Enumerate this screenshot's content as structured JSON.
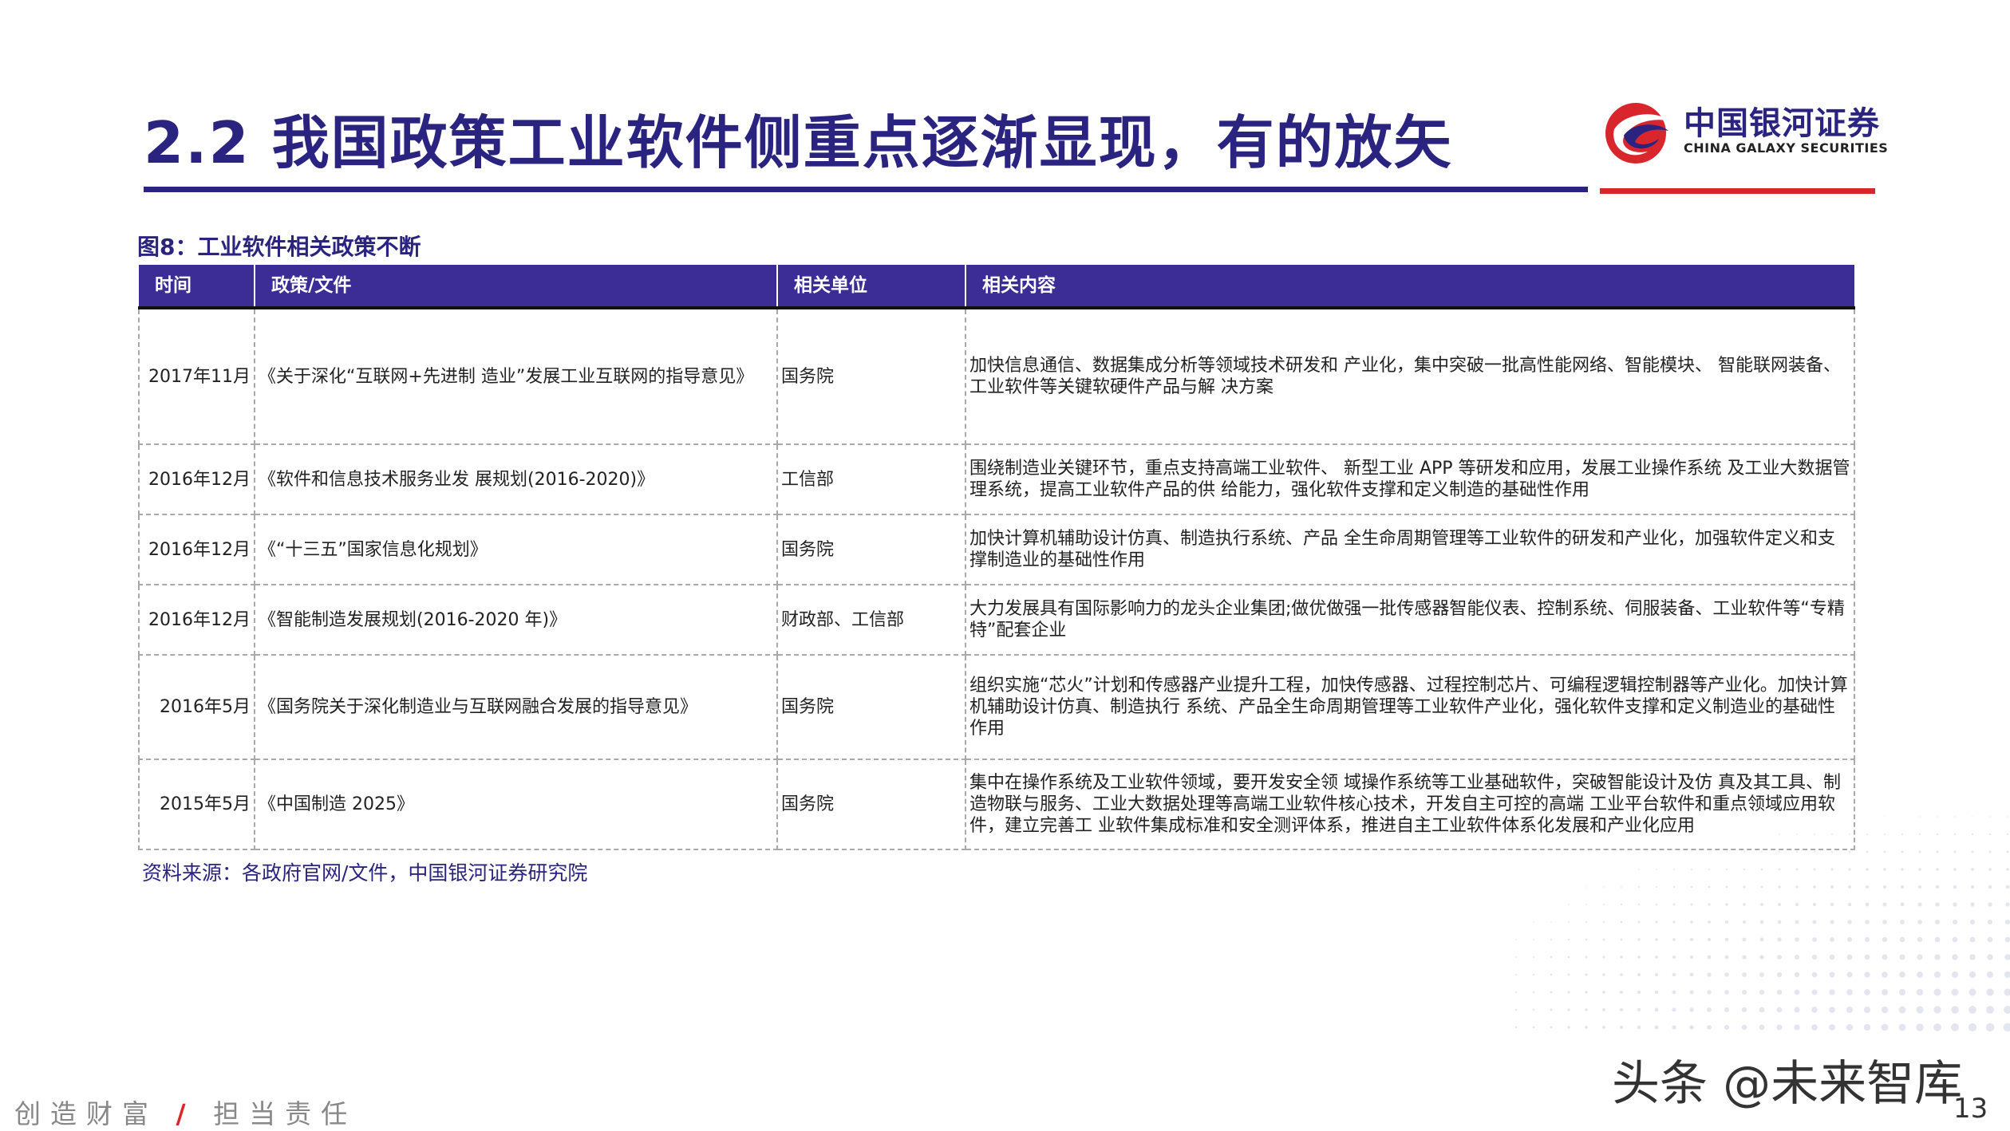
{
  "header": {
    "title": "2.2 我国政策工业软件侧重点逐渐显现，有的放矢",
    "logo_cn": "中国银河证券",
    "logo_en": "CHINA GALAXY SECURITIES"
  },
  "figure": {
    "caption": "图8：工业软件相关政策不断",
    "columns": [
      "时间",
      "政策/文件",
      "相关单位",
      "相关内容"
    ],
    "rows": [
      {
        "time": "2017年11月",
        "doc": "《关于深化“互联网+先进制 造业”发展工业互联网的指导意见》",
        "unit": "国务院",
        "content": "加快信息通信、数据集成分析等领域技术研发和 产业化，集中突破一批高性能网络、智能模块、 智能联网装备、工业软件等关键软硬件产品与解 决方案"
      },
      {
        "time": "2016年12月",
        "doc": "《软件和信息技术服务业发 展规划(2016-2020)》",
        "unit": "工信部",
        "content": " 围绕制造业关键环节，重点支持高端工业软件、 新型工业 APP 等研发和应用，发展工业操作系统 及工业大数据管理系统，提高工业软件产品的供 给能力，强化软件支撑和定义制造的基础性作用"
      },
      {
        "time": "2016年12月",
        "doc": "《“十三五”国家信息化规划》",
        "unit": "国务院",
        "content": "加快计算机辅助设计仿真、制造执行系统、产品 全生命周期管理等工业软件的研发和产业化，加强软件定义和支撑制造业的基础性作用"
      },
      {
        "time": "2016年12月",
        "doc": "《智能制造发展规划(2016-2020 年)》",
        "unit": "财政部、工信部",
        "content": "大力发展具有国际影响力的龙头企业集团;做优做强一批传感器智能仪表、控制系统、伺服装备、工业软件等“专精特”配套企业"
      },
      {
        "time": "2016年5月",
        "doc": "《国务院关于深化制造业与互联网融合发展的指导意见》",
        "unit": "国务院",
        "content": "组织实施“芯火”计划和传感器产业提升工程，加快传感器、过程控制芯片、可编程逻辑控制器等产业化。加快计算机辅助设计仿真、制造执行 系统、产品全生命周期管理等工业软件产业化，强化软件支撑和定义制造业的基础性作用"
      },
      {
        "time": "2015年5月",
        "doc": "《中国制造 2025》",
        "unit": "国务院",
        "content": "集中在操作系统及工业软件领域，要开发安全领 域操作系统等工业基础软件，突破智能设计及仿 真及其工具、制造物联与服务、工业大数据处理等高端工业软件核心技术，开发自主可控的高端 工业平台软件和重点领域应用软件，建立完善工 业软件集成标准和安全测评体系，推进自主工业软件体系化发展和产业化应用"
      }
    ],
    "source": "资料来源：各政府官网/文件，中国银河证券研究院"
  },
  "footer": {
    "slogan_left": "创造财富",
    "slogan_sep": "/",
    "slogan_right": "担当责任",
    "watermark": "头条 @未来智库",
    "page_number": "13"
  },
  "colors": {
    "brand_blue": "#2a2480",
    "header_purple": "#3c2c96",
    "accent_red": "#d9262c"
  }
}
